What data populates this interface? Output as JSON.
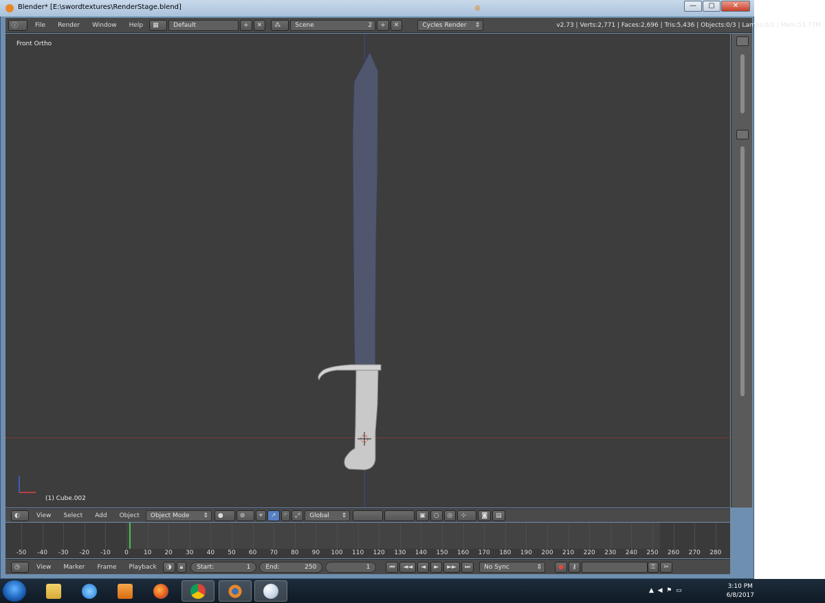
{
  "window": {
    "title": "Blender* [E:\\swordtextures\\RenderStage.blend]",
    "controls": {
      "minimize": "—",
      "maximize": "▢",
      "close": "✕"
    }
  },
  "top_header": {
    "menus": [
      "File",
      "Render",
      "Window",
      "Help"
    ],
    "layout": "Default",
    "scene": "Scene",
    "scene_users": "2",
    "engine": "Cycles Render",
    "stats": "v2.73 | Verts:2,771 | Faces:2,696 | Tris:5,436 | Objects:0/3 | Lamps:0/1 | Mem:53.77M"
  },
  "viewport": {
    "view_label": "Front Ortho",
    "object_label": "(1) Cube.002"
  },
  "view_header": {
    "menus": [
      "View",
      "Select",
      "Add",
      "Object"
    ],
    "mode": "Object Mode",
    "orientation": "Global"
  },
  "timeline": {
    "ticks": [
      "-50",
      "-40",
      "-30",
      "-20",
      "-10",
      "0",
      "10",
      "20",
      "30",
      "40",
      "50",
      "60",
      "70",
      "80",
      "90",
      "100",
      "110",
      "120",
      "130",
      "140",
      "150",
      "160",
      "170",
      "180",
      "190",
      "200",
      "210",
      "220",
      "230",
      "240",
      "250",
      "260",
      "270",
      "280"
    ],
    "current_frame_marker": 1
  },
  "tl_header": {
    "menus": [
      "View",
      "Marker",
      "Frame",
      "Playback"
    ],
    "start_label": "Start:",
    "start_value": "1",
    "end_label": "End:",
    "end_value": "250",
    "current_value": "1",
    "sync": "No Sync"
  },
  "taskbar": {
    "apps": [
      "file-explorer",
      "internet-explorer",
      "media-player",
      "firefox",
      "chrome",
      "blender",
      "paint"
    ],
    "time": "3:10 PM",
    "date": "6/8/2017"
  },
  "colors": {
    "viewport_bg": "#3d3d3d",
    "blade": "#4f566d",
    "handle": "#c9c9c9",
    "accent_orange": "#e8872a"
  }
}
